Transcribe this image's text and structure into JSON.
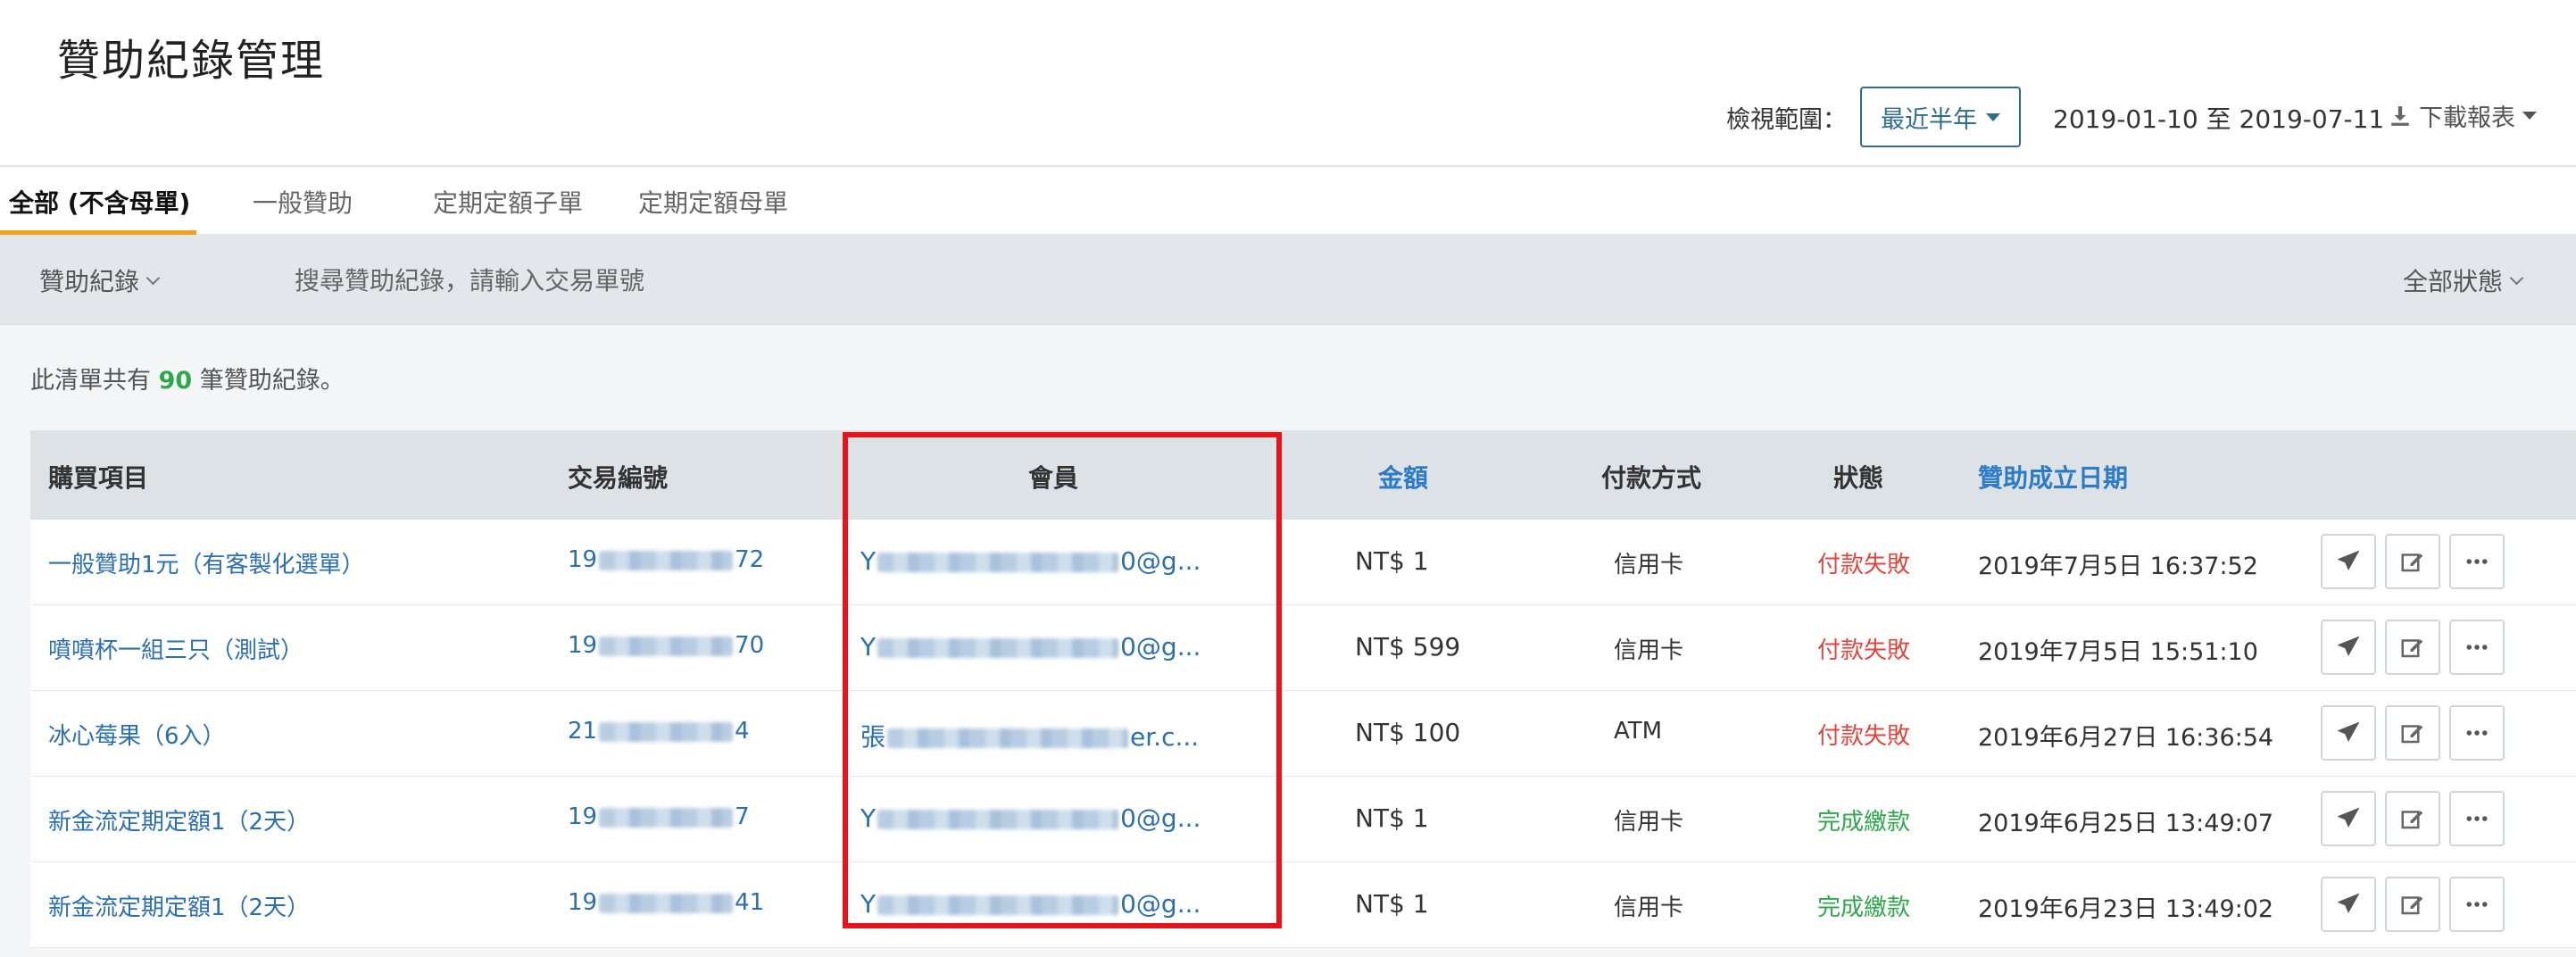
{
  "header": {
    "title": "贊助紀錄管理",
    "range_label": "檢視範圍：",
    "range_value": "最近半年",
    "date_range": "2019-01-10 至 2019-07-11",
    "download_label": "下載報表"
  },
  "tabs": [
    {
      "label": "全部 (不含母單)"
    },
    {
      "label": "一般贊助"
    },
    {
      "label": "定期定額子單"
    },
    {
      "label": "定期定額母單"
    }
  ],
  "toolbar": {
    "type_dropdown": "贊助紀錄",
    "search_placeholder": "搜尋贊助紀錄，請輸入交易單號",
    "status_dropdown": "全部狀態"
  },
  "summary": {
    "prefix": "此清單共有",
    "count": "90",
    "suffix": "筆贊助紀錄。"
  },
  "table": {
    "headers": {
      "item": "購買項目",
      "txn": "交易編號",
      "member": "會員",
      "amount": "金額",
      "payment": "付款方式",
      "status": "狀態",
      "date": "贊助成立日期"
    },
    "rows": [
      {
        "item": "一般贊助1元（有客製化選單）",
        "txn_start": "19",
        "txn_end": "72",
        "member_start": "Y",
        "member_end": "0@g...",
        "amount": "NT$ 1",
        "payment": "信用卡",
        "status": "付款失敗",
        "date": "2019年7月5日 16:37:52"
      },
      {
        "item": "噴噴杯一組三只（測試）",
        "txn_start": "19",
        "txn_end": "70",
        "member_start": "Y",
        "member_end": "0@g...",
        "amount": "NT$ 599",
        "payment": "信用卡",
        "status": "付款失敗",
        "date": "2019年7月5日 15:51:10"
      },
      {
        "item": "冰心莓果（6入）",
        "txn_start": "21",
        "txn_end": "4",
        "member_start": "張",
        "member_end": "er.c...",
        "amount": "NT$ 100",
        "payment": "ATM",
        "status": "付款失敗",
        "date": "2019年6月27日 16:36:54"
      },
      {
        "item": "新金流定期定額1（2天）",
        "txn_start": "19",
        "txn_end": "7",
        "member_start": "Y",
        "member_end": "0@g...",
        "amount": "NT$ 1",
        "payment": "信用卡",
        "status": "完成繳款",
        "date": "2019年6月25日 13:49:07"
      },
      {
        "item": "新金流定期定額1（2天）",
        "txn_start": "19",
        "txn_end": "41",
        "member_start": "Y",
        "member_end": "0@g...",
        "amount": "NT$ 1",
        "payment": "信用卡",
        "status": "完成繳款",
        "date": "2019年6月23日 13:49:02"
      }
    ]
  },
  "colors": {
    "accent": "#2b7bc6",
    "tab_underline": "#f0a21f",
    "fail": "#e0463e",
    "success": "#2ea84a",
    "highlight": "#e8141b"
  }
}
